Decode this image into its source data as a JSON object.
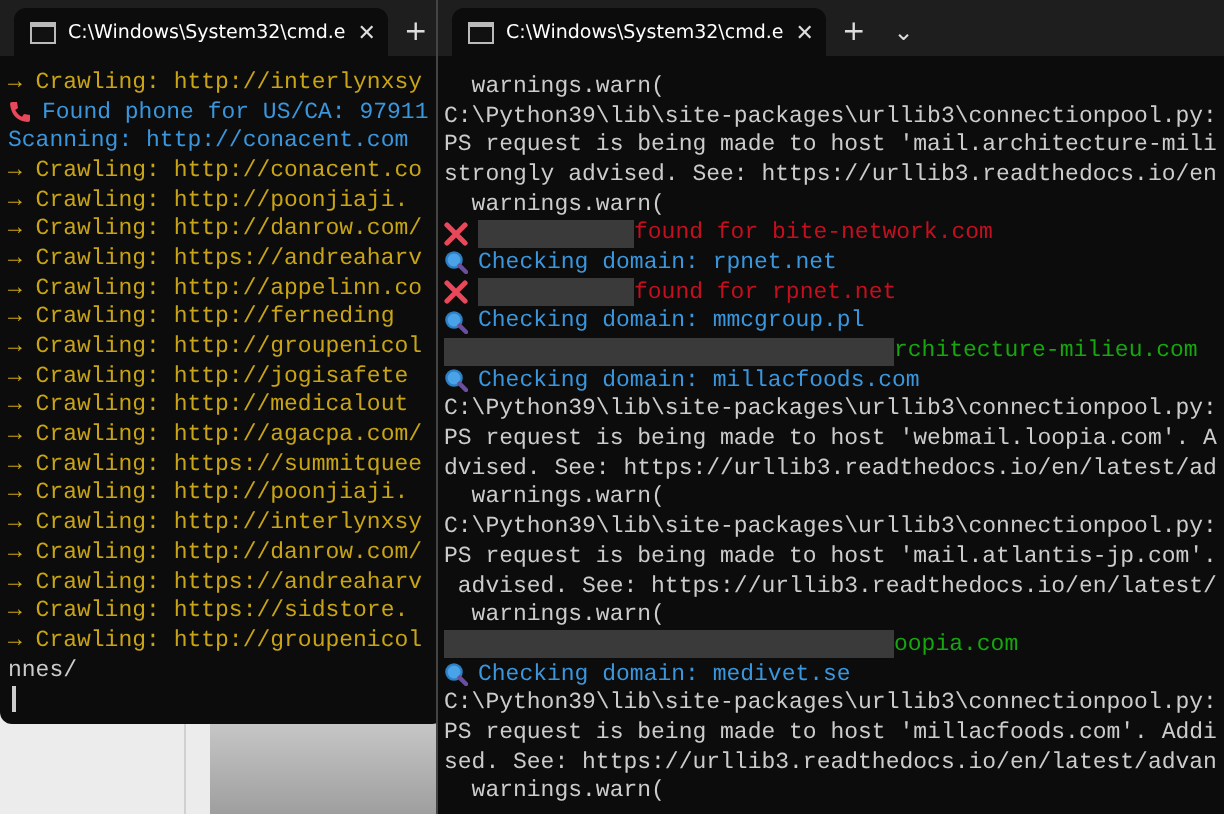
{
  "windows": [
    {
      "tab": {
        "title": "C:\\Windows\\System32\\cmd.e",
        "close": "✕",
        "new_tab": "+"
      },
      "lines": [
        {
          "kind": "crawl",
          "text": "→ Crawling: http://interlynxsy"
        },
        {
          "kind": "phone",
          "text": "Found phone for US/CA: 97911"
        },
        {
          "kind": "scan",
          "text": "Scanning: http://conacent.com"
        },
        {
          "kind": "crawl",
          "text": "→ Crawling: http://conacent.co"
        },
        {
          "kind": "crawl",
          "text": "→ Crawling: http://poonjiaji."
        },
        {
          "kind": "crawl",
          "text": "→ Crawling: http://danrow.com/"
        },
        {
          "kind": "crawl",
          "text": "→ Crawling: https://andreaharv"
        },
        {
          "kind": "crawl",
          "text": "→ Crawling: http://appelinn.co"
        },
        {
          "kind": "crawl",
          "text": "→ Crawling: http://ferneding"
        },
        {
          "kind": "crawl",
          "text": "→ Crawling: http://groupenicol"
        },
        {
          "kind": "crawl",
          "text": "→ Crawling: http://jogisafete"
        },
        {
          "kind": "crawl",
          "text": "→ Crawling: http://medicalout"
        },
        {
          "kind": "crawl",
          "text": "→ Crawling: http://agacpa.com/"
        },
        {
          "kind": "crawl",
          "text": "→ Crawling: https://summitquee"
        },
        {
          "kind": "crawl",
          "text": "→ Crawling: http://poonjiaji."
        },
        {
          "kind": "crawl",
          "text": "→ Crawling: http://interlynxsy"
        },
        {
          "kind": "crawl",
          "text": "→ Crawling: http://danrow.com/"
        },
        {
          "kind": "crawl",
          "text": "→ Crawling: https://andreaharv"
        },
        {
          "kind": "crawl",
          "text": "→ Crawling: https://sidstore."
        },
        {
          "kind": "crawl",
          "text": "→ Crawling: http://groupenicol"
        },
        {
          "kind": "plain",
          "text": "nnes/"
        },
        {
          "kind": "cursor"
        }
      ]
    },
    {
      "tab": {
        "title": "C:\\Windows\\System32\\cmd.e",
        "close": "✕",
        "new_tab": "+",
        "menu": "⌄"
      },
      "lines": [
        {
          "kind": "plain",
          "text": "  warnings.warn("
        },
        {
          "kind": "plain",
          "text": "C:\\Python39\\lib\\site-packages\\urllib3\\connectionpool.py:"
        },
        {
          "kind": "plain",
          "text": "PS request is being made to host 'mail.architecture-mili"
        },
        {
          "kind": "plain",
          "text": "strongly advised. See: https://urllib3.readthedocs.io/en"
        },
        {
          "kind": "plain",
          "text": "  warnings.warn("
        },
        {
          "kind": "error",
          "text": "found for bite-network.com"
        },
        {
          "kind": "check",
          "text": "Checking domain: rpnet.net"
        },
        {
          "kind": "error",
          "text": "found for rpnet.net"
        },
        {
          "kind": "check",
          "text": "Checking domain: mmcgroup.pl"
        },
        {
          "kind": "success",
          "text": "rchitecture-milieu.com"
        },
        {
          "kind": "check",
          "text": "Checking domain: millacfoods.com"
        },
        {
          "kind": "plain",
          "text": "C:\\Python39\\lib\\site-packages\\urllib3\\connectionpool.py:"
        },
        {
          "kind": "plain",
          "text": "PS request is being made to host 'webmail.loopia.com'. A"
        },
        {
          "kind": "plain",
          "text": "dvised. See: https://urllib3.readthedocs.io/en/latest/ad"
        },
        {
          "kind": "plain",
          "text": "  warnings.warn("
        },
        {
          "kind": "plain",
          "text": "C:\\Python39\\lib\\site-packages\\urllib3\\connectionpool.py:"
        },
        {
          "kind": "plain",
          "text": "PS request is being made to host 'mail.atlantis-jp.com'."
        },
        {
          "kind": "plain",
          "text": " advised. See: https://urllib3.readthedocs.io/en/latest/"
        },
        {
          "kind": "plain",
          "text": "  warnings.warn("
        },
        {
          "kind": "success",
          "text": "oopia.com"
        },
        {
          "kind": "check",
          "text": "Checking domain: medivet.se"
        },
        {
          "kind": "plain",
          "text": "C:\\Python39\\lib\\site-packages\\urllib3\\connectionpool.py:"
        },
        {
          "kind": "plain",
          "text": "PS request is being made to host 'millacfoods.com'. Addi"
        },
        {
          "kind": "plain",
          "text": "sed. See: https://urllib3.readthedocs.io/en/latest/advan"
        },
        {
          "kind": "plain",
          "text": "  warnings.warn("
        }
      ]
    }
  ]
}
